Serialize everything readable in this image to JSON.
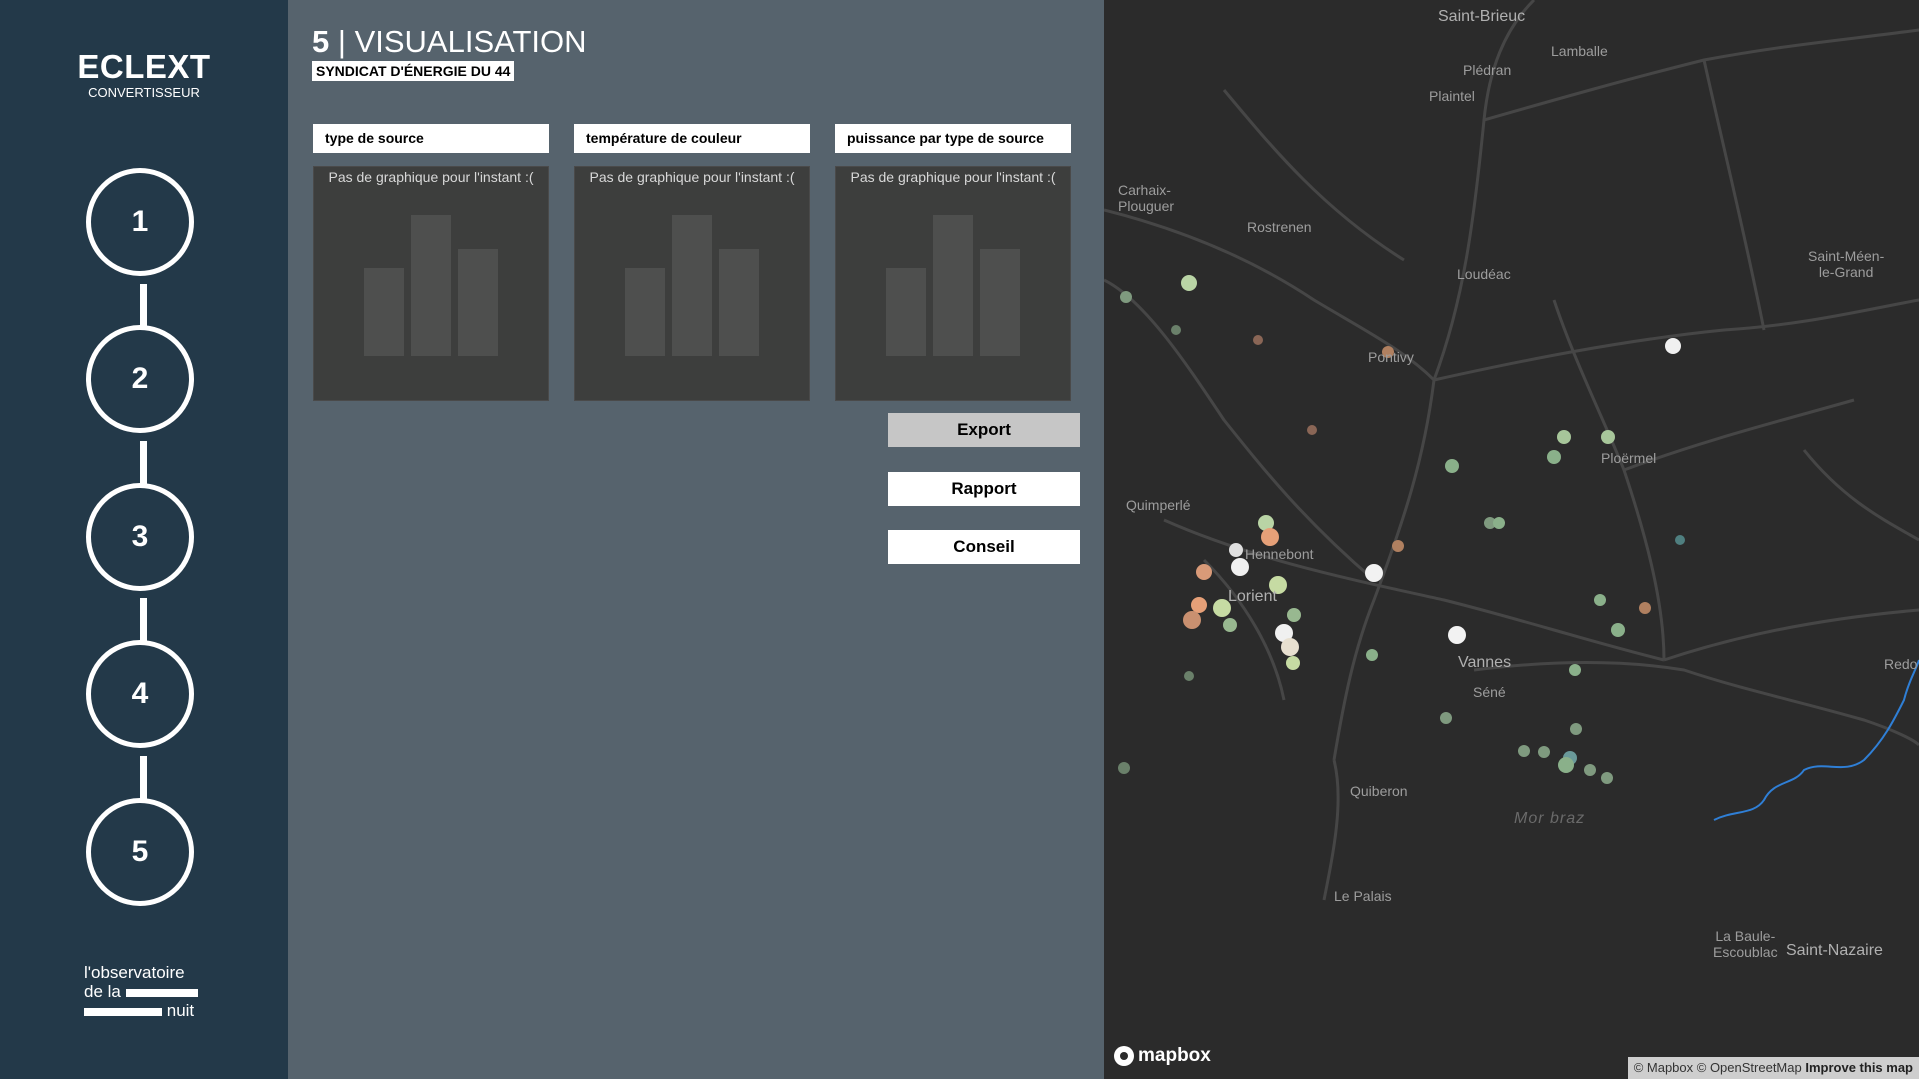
{
  "sidebar": {
    "brand": "ECLEXT",
    "brand_sub": "CONVERTISSEUR",
    "steps": [
      "1",
      "2",
      "3",
      "4",
      "5"
    ],
    "logo_line1": "l'observatoire",
    "logo_line2": "de la",
    "logo_line3": "nuit",
    "toggle_icon": "chevron-right-icon",
    "toggle_glyph": "›"
  },
  "header": {
    "step_number": "5",
    "separator": "|",
    "title": "VISUALISATION",
    "subtitle": "SYNDICAT D'ÉNERGIE DU 44"
  },
  "charts": [
    {
      "label": "type de source",
      "message": "Pas de graphique pour l'instant :("
    },
    {
      "label": "température de couleur",
      "message": "Pas de graphique pour l'instant :("
    },
    {
      "label": "puissance par type de source",
      "message": "Pas de graphique pour l'instant :("
    }
  ],
  "actions": {
    "export": "Export",
    "rapport": "Rapport",
    "conseil": "Conseil"
  },
  "map": {
    "places": {
      "saint_brieuc": "Saint-Brieuc",
      "lamballe": "Lamballe",
      "pledran": "Plédran",
      "plaintel": "Plaintel",
      "carhaix": "Carhaix-\nPlouguer",
      "rostrenen": "Rostrenen",
      "loudeac": "Loudéac",
      "saint_meen": "Saint-Méen-\nle-Grand",
      "pontivy": "Pontivy",
      "ploermel": "Ploërmel",
      "quimperle": "Quimperlé",
      "hennebont": "Hennebont",
      "lorient": "Lorient",
      "vannes": "Vannes",
      "sene": "Séné",
      "redon": "Redo",
      "quiberon": "Quiberon",
      "mor_braz": "Mor braz",
      "le_palais": "Le Palais",
      "la_baule": "La Baule-\nEscoublac",
      "saint_nazaire": "Saint-Nazaire"
    },
    "logo": "mapbox",
    "attribution": "© Mapbox © OpenStreetMap",
    "improve": "Improve this map",
    "colors": {
      "background": "#2b2b2b",
      "roads": "#4a4a4a",
      "river": "#2f7fd6"
    }
  }
}
